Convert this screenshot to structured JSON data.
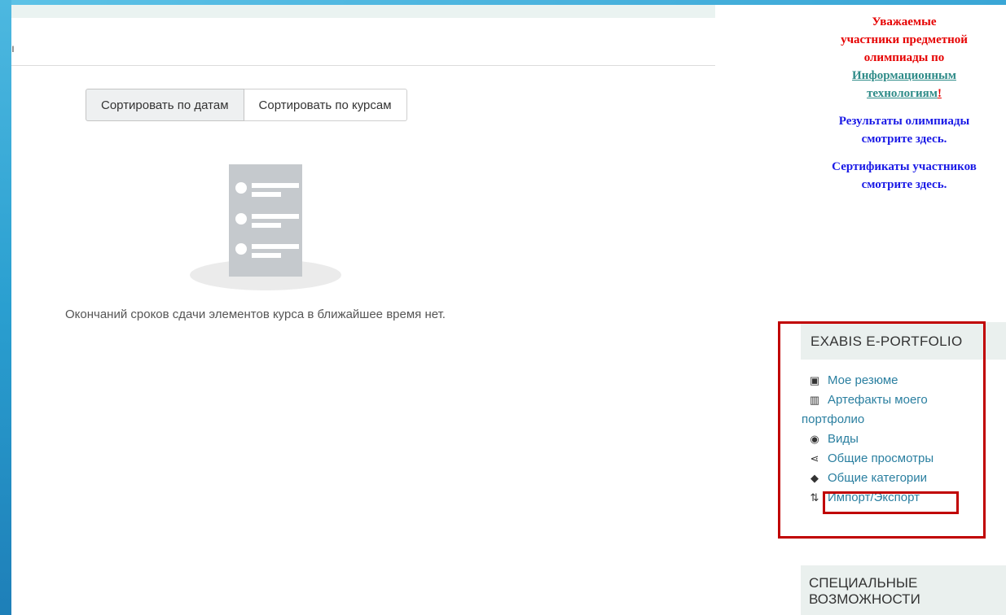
{
  "sort": {
    "by_dates": "Сортировать по датам",
    "by_courses": "Сортировать по курсам"
  },
  "main": {
    "cut_glyph": "ı",
    "empty_text": "Окончаний сроков сдачи элементов курса в ближайшее время нет."
  },
  "announcement": {
    "line1": "Уважаемые",
    "line2": "участники предметной",
    "line3": "олимпиады по",
    "link_line1": "Информационным",
    "link_line2": "технологиям",
    "exclam": "!",
    "results1": "Результаты олимпиады",
    "results2": "смотрите здесь.",
    "certs1": "Сертификаты участников",
    "certs2": "смотрите здесь."
  },
  "portfolio": {
    "title": "EXABIS E-PORTFOLIO",
    "items": [
      {
        "label": "Мое резюме",
        "icon": "resume-icon"
      },
      {
        "label": "Артефакты моего",
        "label2": "портфолио",
        "icon": "artifacts-icon"
      },
      {
        "label": "Виды",
        "icon": "eye-icon"
      },
      {
        "label": "Общие просмотры",
        "icon": "share-icon"
      },
      {
        "label": "Общие категории",
        "icon": "tags-icon"
      },
      {
        "label": "Импорт/Экспорт",
        "icon": "import-export-icon"
      }
    ]
  },
  "accessibility": {
    "title_line1": "СПЕЦИАЛЬНЫЕ",
    "title_line2": "ВОЗМОЖНОСТИ"
  },
  "colors": {
    "accent_red": "#c00000",
    "link": "#2a7fa0"
  }
}
